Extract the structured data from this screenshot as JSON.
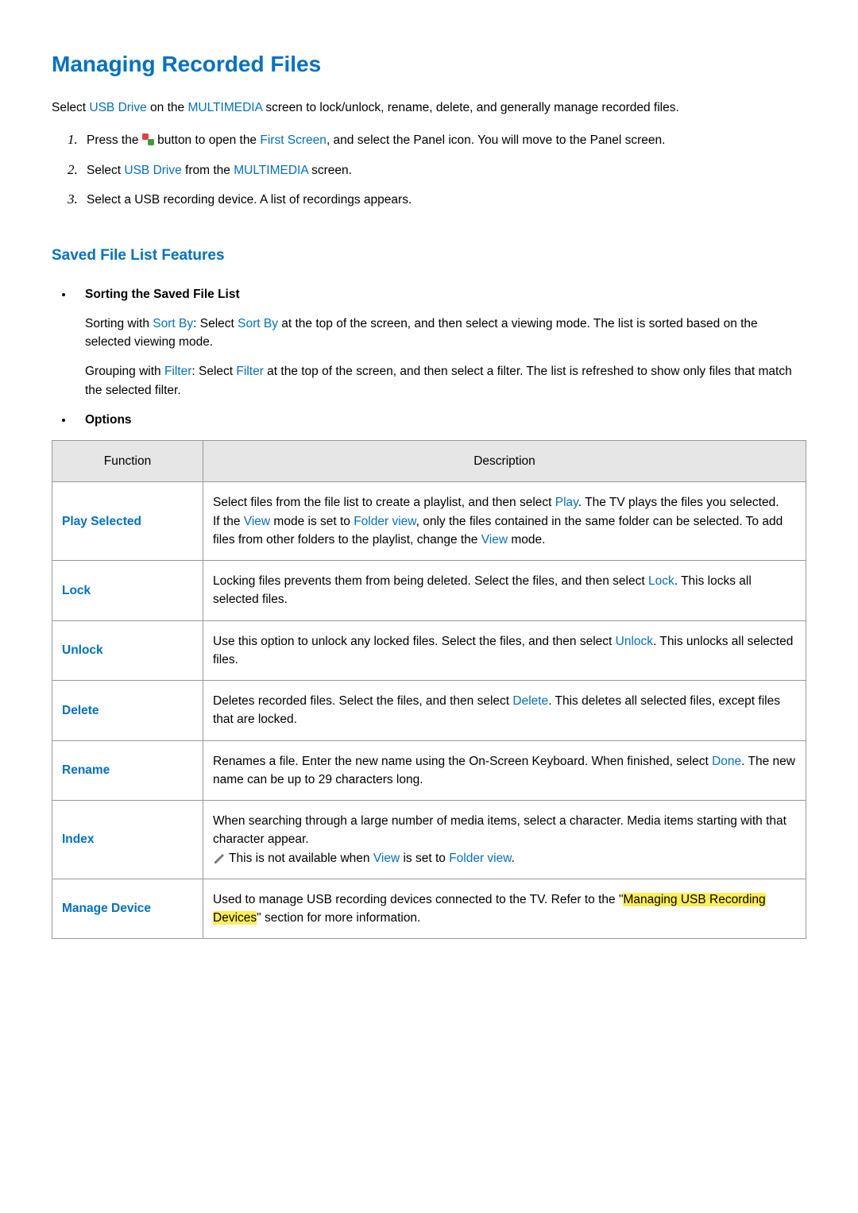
{
  "title": "Managing Recorded Files",
  "intro": {
    "pre": "Select ",
    "usb": "USB Drive",
    "mid1": " on the ",
    "mm": "MULTIMEDIA",
    "post": " screen to lock/unlock, rename, delete, and generally manage recorded files."
  },
  "steps": {
    "one": {
      "pre": "Press the ",
      "mid": " button to open the ",
      "fs": "First Screen",
      "post": ", and select the Panel icon. You will move to the Panel screen."
    },
    "two": {
      "pre": "Select ",
      "usb": "USB Drive",
      "mid": " from the ",
      "mm": "MULTIMEDIA",
      "post": " screen."
    },
    "three": "Select a USB recording device. A list of recordings appears."
  },
  "saved_h2": "Saved File List Features",
  "bullets": {
    "sort_title": "Sorting the Saved File List",
    "sort_p1": {
      "pre": "Sorting with ",
      "sb1": "Sort By",
      "mid": ": Select ",
      "sb2": "Sort By",
      "post": " at the top of the screen, and then select a viewing mode. The list is sorted based on the selected viewing mode."
    },
    "sort_p2": {
      "pre": "Grouping with ",
      "f1": "Filter",
      "mid": ": Select ",
      "f2": "Filter",
      "post": " at the top of the screen, and then select a filter. The list is refreshed to show only files that match the selected filter."
    },
    "options_title": "Options"
  },
  "table": {
    "head_func": "Function",
    "head_desc": "Description",
    "play_selected": {
      "label": "Play Selected",
      "p1": "Select files from the file list to create a playlist, and then select ",
      "play": "Play",
      "p2": ". The TV plays the files you selected.",
      "p3": "If the ",
      "view": "View",
      "p4": " mode is set to ",
      "fv": "Folder view",
      "p5": ", only the files contained in the same folder can be selected. To add files from other folders to the playlist, change the ",
      "view2": "View",
      "p6": " mode."
    },
    "lock": {
      "label": "Lock",
      "p1": "Locking files prevents them from being deleted. Select the files, and then select ",
      "lk": "Lock",
      "p2": ". This locks all selected files."
    },
    "unlock": {
      "label": "Unlock",
      "p1": "Use this option to unlock any locked files. Select the files, and then select ",
      "ul": "Unlock",
      "p2": ". This unlocks all selected files."
    },
    "del": {
      "label": "Delete",
      "p1": "Deletes recorded files. Select the files, and then select ",
      "dl": "Delete",
      "p2": ". This deletes all selected files, except files that are locked."
    },
    "rename": {
      "label": "Rename",
      "p1": "Renames a file. Enter the new name using the On-Screen Keyboard. When finished, select ",
      "done": "Done",
      "p2": ". The new name can be up to 29 characters long."
    },
    "index": {
      "label": "Index",
      "p1": "When searching through a large number of media items, select a character. Media items starting with that character appear.",
      "note_pre": "This is not available when ",
      "view": "View",
      "note_mid": " is set to ",
      "fv": "Folder view",
      "note_post": "."
    },
    "manage": {
      "label": "Manage Device",
      "p1": "Used to manage USB recording devices connected to the TV. Refer to the \"",
      "link": "Managing USB Recording Devices",
      "p2": "\" section for more information."
    }
  }
}
